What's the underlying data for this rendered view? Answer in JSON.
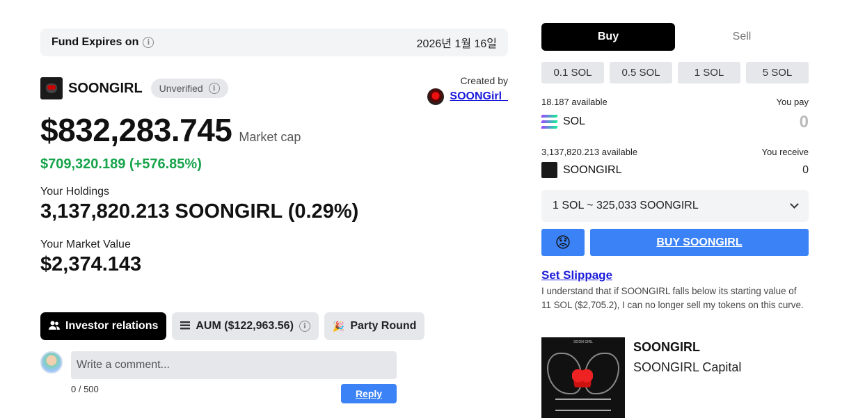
{
  "fund": {
    "expires_label": "Fund Expires on",
    "expires_date": "2026년 1월 16일"
  },
  "token": {
    "name": "SOONGIRL",
    "badge": "Unverified",
    "created_by_label": "Created by",
    "creator": "SOONGirl_",
    "market_cap": "$832,283.745",
    "market_cap_label": "Market cap",
    "change": "$709,320.189 (+576.85%)"
  },
  "holdings": {
    "label": "Your Holdings",
    "value": "3,137,820.213 SOONGIRL (0.29%)",
    "market_value_label": "Your Market Value",
    "market_value": "$2,374.143"
  },
  "tabs": [
    {
      "label": "Investor relations",
      "icon": "users-icon",
      "active": true
    },
    {
      "label": "AUM ($122,963.56)",
      "icon": "stack-icon",
      "active": false
    },
    {
      "label": "Party Round",
      "icon": "party-popper-icon",
      "active": false
    }
  ],
  "comment": {
    "placeholder": "Write a comment...",
    "counter": "0 / 500",
    "reply_label": "Reply"
  },
  "trade": {
    "buy_label": "Buy",
    "sell_label": "Sell",
    "amounts": [
      "0.1 SOL",
      "0.5 SOL",
      "1 SOL",
      "5 SOL"
    ],
    "pay_available": "18.187 available",
    "pay_label": "You pay",
    "pay_token": "SOL",
    "pay_amount": "0",
    "receive_available": "3,137,820.213 available",
    "receive_label": "You receive",
    "receive_token": "SOONGIRL",
    "receive_amount": "0",
    "rate": "1 SOL ~ 325,033 SOONGIRL",
    "emoji": "😟",
    "buy_button": "BUY SOONGIRL",
    "slippage_link": "Set Slippage",
    "disclaimer": "I understand that if SOONGIRL falls below its starting value of 11 SOL ($2,705.2), I can no longer sell my tokens on this curve."
  },
  "fund_card": {
    "title": "SOONGIRL",
    "subtitle": "SOONGIRL Capital",
    "image_text": "SOON GIRL"
  },
  "colors": {
    "accent_blue": "#3b82f6",
    "positive_green": "#16a34a",
    "link_blue": "#1a1adb"
  }
}
